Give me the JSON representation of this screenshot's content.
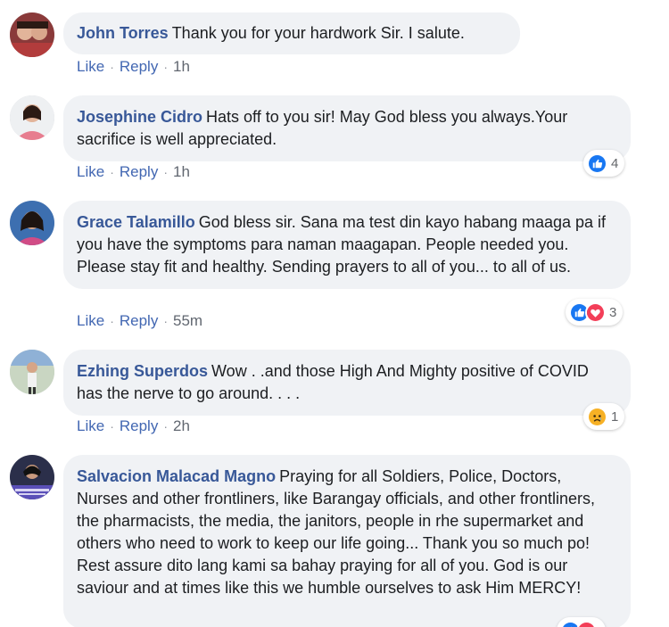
{
  "comments": [
    {
      "author": "John Torres",
      "text": "Thank you for your hardwork Sir. I salute.",
      "actions": {
        "like": "Like",
        "reply": "Reply",
        "time": "1h"
      }
    },
    {
      "author": "Josephine Cidro",
      "text": "Hats off to you sir! May God bless you always.Your sacrifice is well appreciated.",
      "actions": {
        "like": "Like",
        "reply": "Reply",
        "time": "1h"
      },
      "reactions": {
        "icons": [
          "like-icon"
        ],
        "count": "4"
      }
    },
    {
      "author": "Grace Talamillo",
      "text": "God bless sir. Sana ma test din kayo habang maaga pa if you have the symptoms para naman maagapan. People needed you. Please stay fit and healthy. Sending prayers to all of you... to all of us.",
      "actions": {
        "like": "Like",
        "reply": "Reply",
        "time": "55m"
      },
      "reactions": {
        "icons": [
          "like-icon",
          "love-icon"
        ],
        "count": "3"
      }
    },
    {
      "author": "Ezhing Superdos",
      "text": "Wow . .and those High And Mighty positive of COVID has the nerve to go around. . . .",
      "actions": {
        "like": "Like",
        "reply": "Reply",
        "time": "2h"
      },
      "reactions": {
        "icons": [
          "sad-icon"
        ],
        "count": "1"
      }
    },
    {
      "author": "Salvacion Malacad Magno",
      "text": "Praying for all Soldiers, Police, Doctors, Nurses and other frontliners, like Barangay officials, and other frontliners, the pharmacists, the media, the janitors, people in rhe supermarket and others who need to work to keep our life going... Thank you so much po! Rest assure dito lang kami sa bahay praying for all of you. God is our saviour and at times like this we humble ourselves to ask Him MERCY!",
      "reactions": {
        "icons": [
          "like-icon",
          "love-icon"
        ]
      }
    }
  ],
  "colors": {
    "author_link": "#385898",
    "bubble_bg": "#f0f2f5",
    "like_blue": "#1877f2",
    "love_red": "#f33e58",
    "sad_yellow": "#f7b125"
  }
}
